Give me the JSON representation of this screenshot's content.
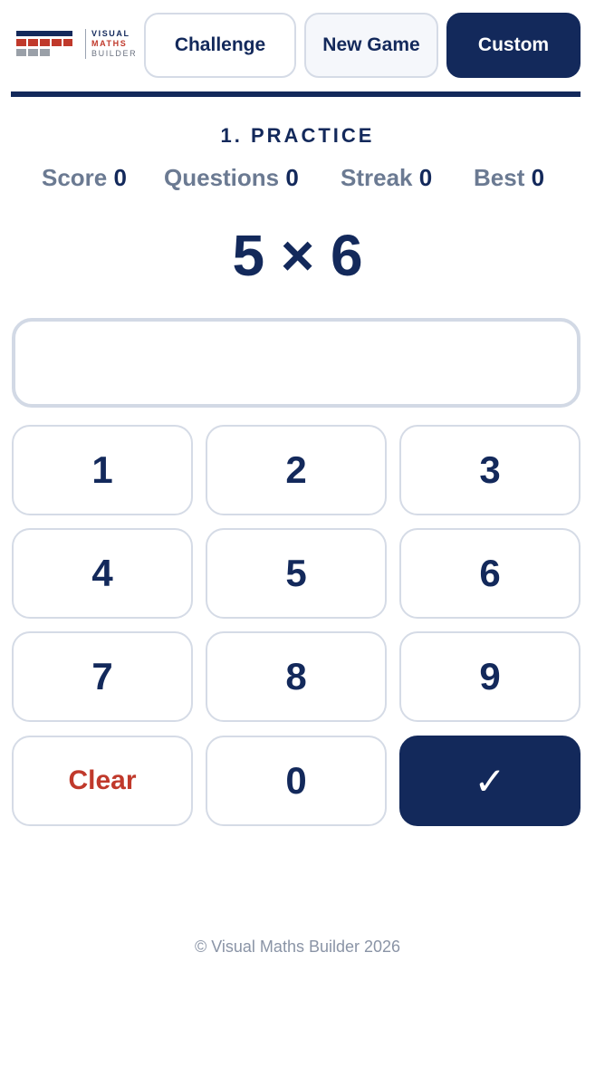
{
  "logo": {
    "line1": "VISUAL",
    "line2": "MATHS",
    "line3": "BUILDER"
  },
  "nav": {
    "challenge": "Challenge",
    "new_game": "New Game",
    "custom": "Custom"
  },
  "mode_title": "1. PRACTICE",
  "stats": {
    "score_label": "Score",
    "score": "0",
    "questions_label": "Questions",
    "questions": "0",
    "streak_label": "Streak",
    "streak": "0",
    "best_label": "Best",
    "best": "0"
  },
  "question": "5 × 6",
  "answer_value": "",
  "keypad": {
    "k1": "1",
    "k2": "2",
    "k3": "3",
    "k4": "4",
    "k5": "5",
    "k6": "6",
    "k7": "7",
    "k8": "8",
    "k9": "9",
    "clear": "Clear",
    "k0": "0",
    "submit": "✓"
  },
  "footer": "© Visual Maths Builder 2026",
  "colors": {
    "primary": "#13295b",
    "accent_red": "#c0392b",
    "muted": "#6b7a92",
    "border": "#d5dbe6"
  }
}
